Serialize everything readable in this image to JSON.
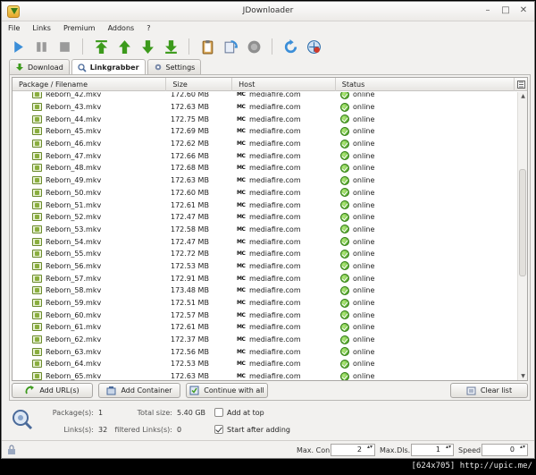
{
  "window": {
    "title": "JDownloader",
    "controls": [
      "minimize",
      "maximize",
      "close"
    ]
  },
  "menu": [
    "File",
    "Links",
    "Premium",
    "Addons",
    "?"
  ],
  "toolbar": [
    {
      "name": "start-download-icon",
      "color": "#3b8ed8"
    },
    {
      "name": "pause-download-icon",
      "color": "#9a9a9a"
    },
    {
      "name": "stop-download-icon",
      "color": "#9a9a9a"
    },
    {
      "name": "move-top-icon",
      "color": "#3c9a1c"
    },
    {
      "name": "move-up-icon",
      "color": "#3c9a1c"
    },
    {
      "name": "move-down-icon",
      "color": "#3c9a1c"
    },
    {
      "name": "move-bottom-icon",
      "color": "#3c9a1c"
    },
    {
      "name": "clipboard-icon",
      "color": "#b07a2a"
    },
    {
      "name": "reconnect-icon",
      "color": "#3b8ed8"
    },
    {
      "name": "premium-icon",
      "color": "#9a9a9a"
    },
    {
      "name": "refresh-icon",
      "color": "#3b8ed8"
    },
    {
      "name": "update-icon",
      "color": "#2a6aa8"
    }
  ],
  "tabs": [
    {
      "label": "Download",
      "icon": "download-arrow-icon",
      "active": false
    },
    {
      "label": "Linkgrabber",
      "icon": "linkgrabber-icon",
      "active": true
    },
    {
      "label": "Settings",
      "icon": "settings-gear-icon",
      "active": false
    }
  ],
  "table": {
    "columns": [
      "Package / Filename",
      "Size",
      "Host",
      "Status"
    ],
    "rows": [
      {
        "name": "Reborn_42.mkv",
        "size": "172.60 MB",
        "host": "mediafire.com",
        "status": "online"
      },
      {
        "name": "Reborn_43.mkv",
        "size": "172.63 MB",
        "host": "mediafire.com",
        "status": "online"
      },
      {
        "name": "Reborn_44.mkv",
        "size": "172.75 MB",
        "host": "mediafire.com",
        "status": "online"
      },
      {
        "name": "Reborn_45.mkv",
        "size": "172.69 MB",
        "host": "mediafire.com",
        "status": "online"
      },
      {
        "name": "Reborn_46.mkv",
        "size": "172.62 MB",
        "host": "mediafire.com",
        "status": "online"
      },
      {
        "name": "Reborn_47.mkv",
        "size": "172.66 MB",
        "host": "mediafire.com",
        "status": "online"
      },
      {
        "name": "Reborn_48.mkv",
        "size": "172.68 MB",
        "host": "mediafire.com",
        "status": "online"
      },
      {
        "name": "Reborn_49.mkv",
        "size": "172.63 MB",
        "host": "mediafire.com",
        "status": "online"
      },
      {
        "name": "Reborn_50.mkv",
        "size": "172.60 MB",
        "host": "mediafire.com",
        "status": "online"
      },
      {
        "name": "Reborn_51.mkv",
        "size": "172.61 MB",
        "host": "mediafire.com",
        "status": "online"
      },
      {
        "name": "Reborn_52.mkv",
        "size": "172.47 MB",
        "host": "mediafire.com",
        "status": "online"
      },
      {
        "name": "Reborn_53.mkv",
        "size": "172.58 MB",
        "host": "mediafire.com",
        "status": "online"
      },
      {
        "name": "Reborn_54.mkv",
        "size": "172.47 MB",
        "host": "mediafire.com",
        "status": "online"
      },
      {
        "name": "Reborn_55.mkv",
        "size": "172.72 MB",
        "host": "mediafire.com",
        "status": "online"
      },
      {
        "name": "Reborn_56.mkv",
        "size": "172.53 MB",
        "host": "mediafire.com",
        "status": "online"
      },
      {
        "name": "Reborn_57.mkv",
        "size": "172.91 MB",
        "host": "mediafire.com",
        "status": "online"
      },
      {
        "name": "Reborn_58.mkv",
        "size": "173.48 MB",
        "host": "mediafire.com",
        "status": "online"
      },
      {
        "name": "Reborn_59.mkv",
        "size": "172.51 MB",
        "host": "mediafire.com",
        "status": "online"
      },
      {
        "name": "Reborn_60.mkv",
        "size": "172.57 MB",
        "host": "mediafire.com",
        "status": "online"
      },
      {
        "name": "Reborn_61.mkv",
        "size": "172.61 MB",
        "host": "mediafire.com",
        "status": "online"
      },
      {
        "name": "Reborn_62.mkv",
        "size": "172.37 MB",
        "host": "mediafire.com",
        "status": "online"
      },
      {
        "name": "Reborn_63.mkv",
        "size": "172.56 MB",
        "host": "mediafire.com",
        "status": "online"
      },
      {
        "name": "Reborn_64.mkv",
        "size": "172.53 MB",
        "host": "mediafire.com",
        "status": "online"
      },
      {
        "name": "Reborn_65.mkv",
        "size": "172.63 MB",
        "host": "mediafire.com",
        "status": "online"
      }
    ]
  },
  "buttons": {
    "add_url": "Add URL(s)",
    "add_container": "Add Container",
    "continue_all": "Continue with all",
    "clear_list": "Clear list"
  },
  "info": {
    "packages_label": "Package(s):",
    "packages_value": "1",
    "links_label": "Links(s):",
    "links_value": "32",
    "total_size_label": "Total size:",
    "total_size_value": "5.40 GB",
    "filtered_label": "filtered Links(s):",
    "filtered_value": "0",
    "add_at_top_label": "Add at top",
    "add_at_top_checked": false,
    "start_after_label": "Start after adding",
    "start_after_checked": true
  },
  "statusbar": {
    "max_con_label": "Max. Con.",
    "max_con_value": "2",
    "max_dls_label": "Max.Dls.",
    "max_dls_value": "1",
    "speed_label": "Speed",
    "speed_value": "0"
  },
  "watermark": "[624x705] http://upic.me/"
}
